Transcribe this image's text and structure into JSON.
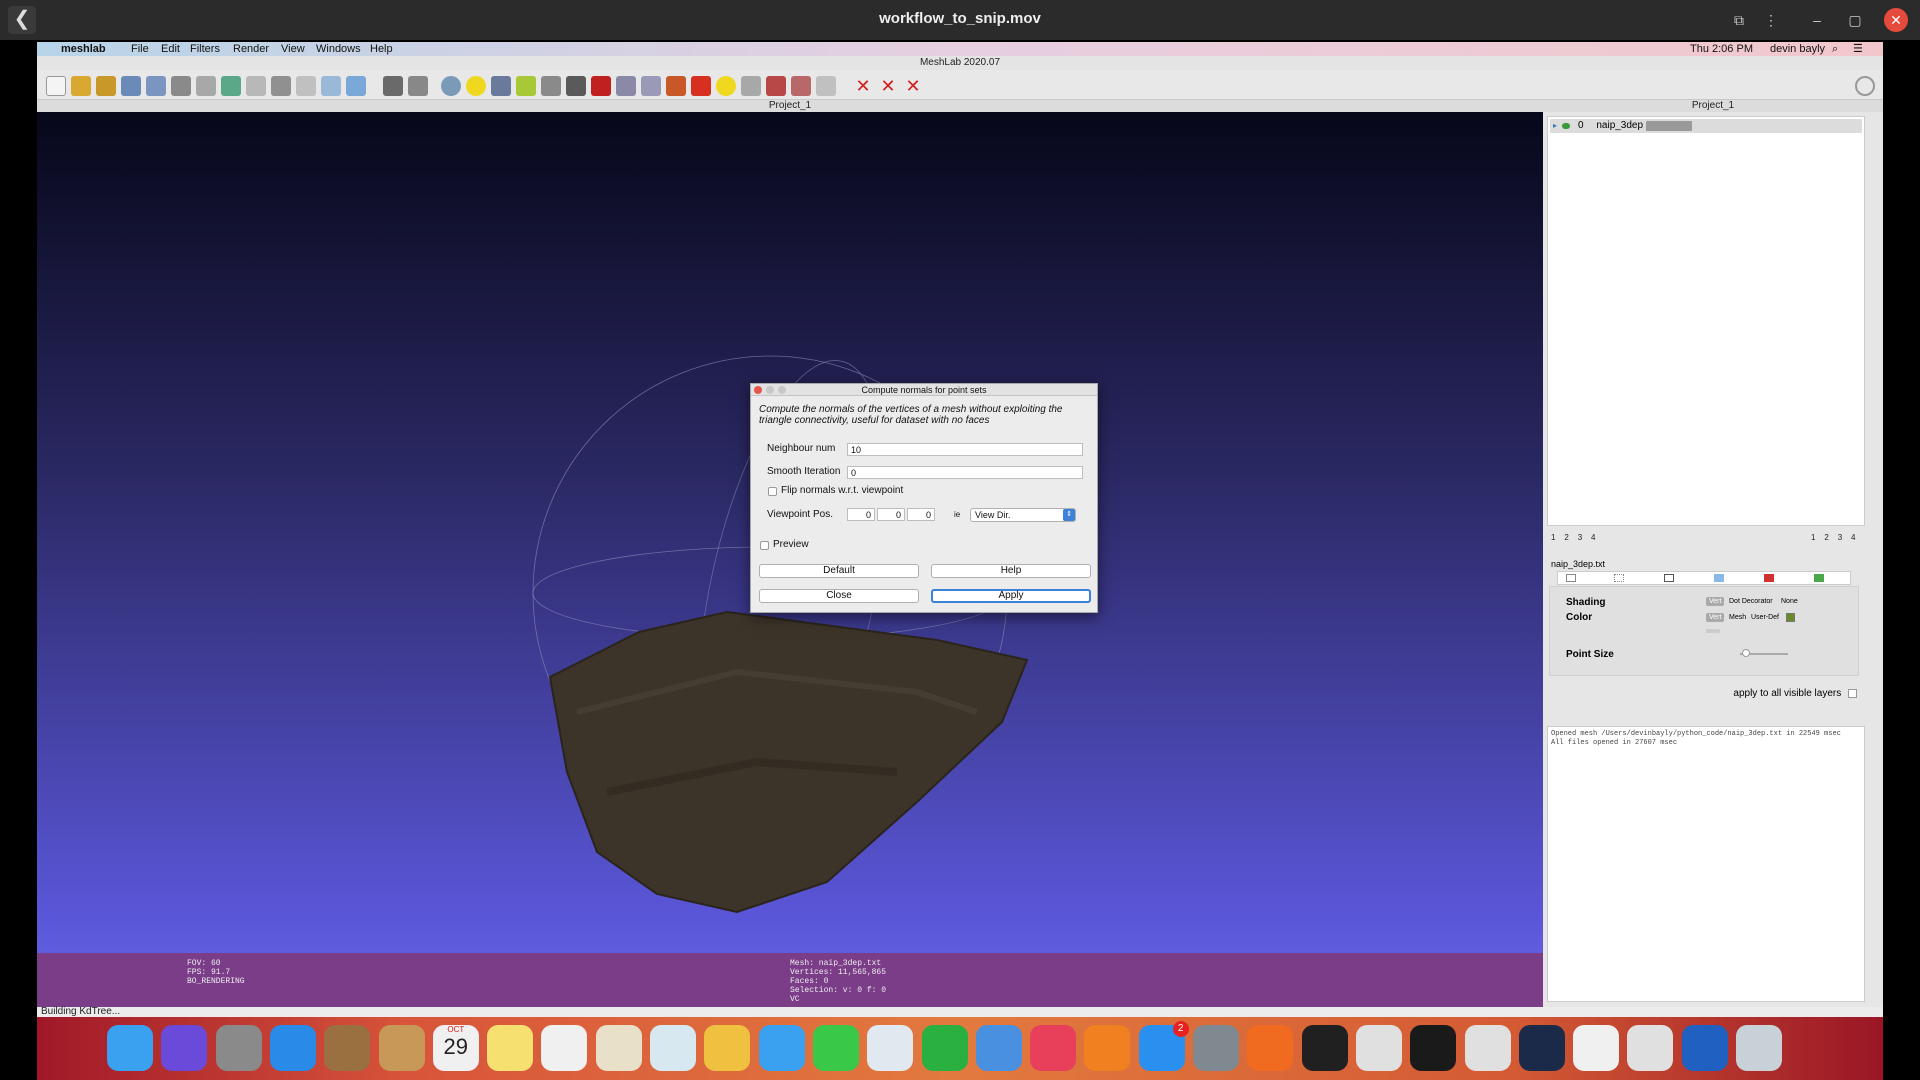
{
  "player": {
    "title": "workflow_to_snip.mov",
    "back": "❮",
    "cast": "⧉",
    "more": "⋮",
    "minimize": "–",
    "maximize": "▢",
    "close": "✕"
  },
  "menubar": {
    "apple": "",
    "app": "meshlab",
    "items": [
      "File",
      "Edit",
      "Filters",
      "Render",
      "View",
      "Windows",
      "Help"
    ],
    "clock": "Thu 2:06 PM",
    "user": "devin bayly"
  },
  "app_title": "MeshLab 2020.07",
  "doc_title": "Project_1",
  "layers_title": "Project_1",
  "viewport": {
    "info_left": [
      "FOV: 60",
      "FPS:   91.7",
      "BO_RENDERING"
    ],
    "info_right": [
      "Mesh: naip_3dep.txt",
      "Vertices: 11,565,865",
      "Faces: 0",
      "Selection: v: 0 f: 0",
      "VC"
    ]
  },
  "status": "Building KdTree...",
  "dialog": {
    "title": "Compute normals for point sets",
    "description": "Compute the normals of the vertices of a mesh without exploiting the triangle connectivity, useful for dataset with no faces",
    "neighbour_label": "Neighbour num",
    "neighbour_value": "10",
    "smooth_label": "Smooth Iteration",
    "smooth_value": "0",
    "flip_label": "Flip normals w.r.t. viewpoint",
    "viewpoint_label": "Viewpoint Pos.",
    "vp_x": "0",
    "vp_y": "0",
    "vp_z": "0",
    "vp_sep": "ie",
    "vp_select": "View Dir.",
    "preview_label": "Preview",
    "default_btn": "Default",
    "help_btn": "Help",
    "close_btn": "Close",
    "apply_btn": "Apply"
  },
  "layers": {
    "item_index": "0",
    "item_name": "naip_3dep",
    "left_nums": [
      "1",
      "2",
      "3",
      "4"
    ],
    "right_nums": [
      "1",
      "2",
      "3",
      "4"
    ],
    "mesh_name": "naip_3dep.txt",
    "shading_label": "Shading",
    "shading_opts": [
      "Vert",
      "Dot Decorator",
      "None"
    ],
    "color_label": "Color",
    "color_opts": [
      "Vert",
      "Mesh",
      "User-Def"
    ],
    "point_size_label": "Point Size",
    "apply_all_label": "apply to all visible layers",
    "user_color": "#6a8a2a"
  },
  "log": [
    "Opened mesh /Users/devinbayly/python_code/naip_3dep.txt in 22549 msec",
    "All files opened in 27607 msec"
  ],
  "dock": {
    "icons": [
      "finder-icon",
      "siri-icon",
      "launchpad-icon",
      "safari-icon",
      "mail-icon",
      "notes-icon",
      "calendar-icon",
      "stickies-icon",
      "reminders-icon",
      "maps-icon",
      "meshlab-icon",
      "photos-icon",
      "messages-icon",
      "facetime-icon",
      "keynote-icon",
      "numbers-icon",
      "keynote2-icon",
      "music-icon",
      "books-icon",
      "appstore-icon",
      "settings-icon",
      "firefox-icon",
      "activity-icon",
      "blender-icon",
      "terminal-icon",
      "chrome-icon",
      "steam-icon",
      "textedit-icon",
      "eye-icon",
      "quicktime-icon",
      "trash-icon"
    ],
    "calendar_month": "OCT",
    "calendar_day": "29",
    "appstore_badge": "2"
  }
}
